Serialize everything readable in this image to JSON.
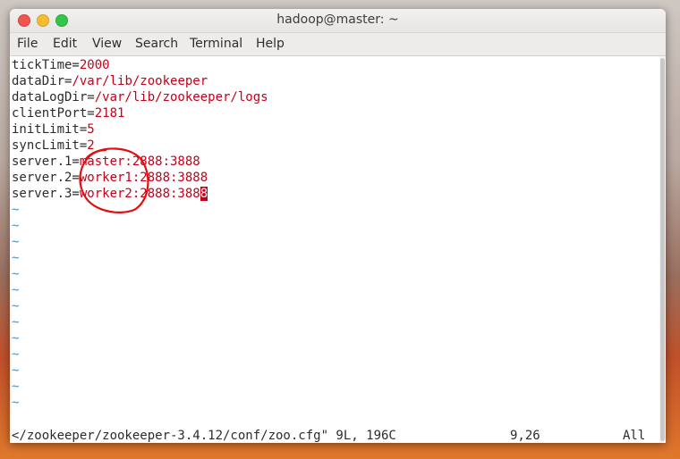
{
  "window": {
    "title": "hadoop@master: ~"
  },
  "menu": [
    "File",
    "Edit",
    "View",
    "Search",
    "Terminal",
    "Help"
  ],
  "config_lines": [
    {
      "key": "tickTime=",
      "value": "2000"
    },
    {
      "key": "dataDir=",
      "value": "/var/lib/zookeeper"
    },
    {
      "key": "dataLogDir=",
      "value": "/var/lib/zookeeper/logs"
    },
    {
      "key": "clientPort=",
      "value": "2181"
    },
    {
      "key": "initLimit=",
      "value": "5"
    },
    {
      "key": "syncLimit=",
      "value": "2"
    },
    {
      "key": "server.1=",
      "value": "master:2888:3888"
    },
    {
      "key": "server.2=",
      "value": "worker1:2888:3888"
    },
    {
      "key": "server.3=",
      "value": "worker2:2888:388",
      "cursor_char": "8"
    }
  ],
  "empty_line_marker": "~",
  "empty_line_count": 13,
  "status": {
    "file": "</zookeeper/zookeeper-3.4.12/conf/zoo.cfg\" 9L, 196C",
    "position": "9,26",
    "scroll": "All"
  },
  "colors": {
    "value_text": "#c4001b",
    "tilde": "#4b8fc2",
    "annotation_circle": "#e01010"
  }
}
